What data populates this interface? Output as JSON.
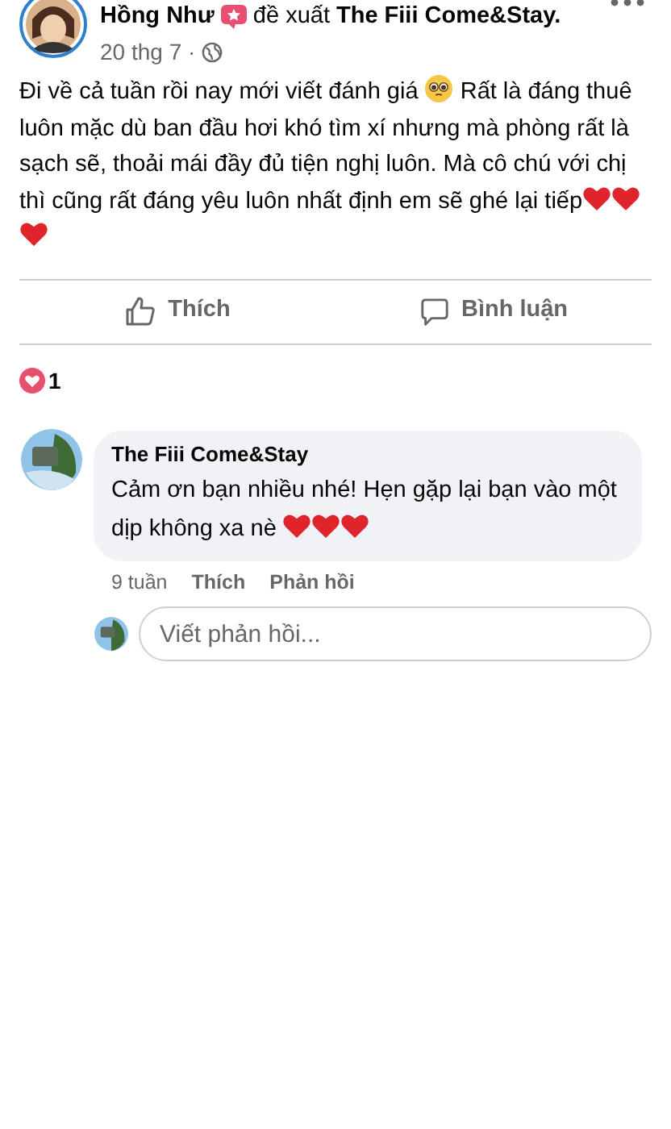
{
  "post": {
    "author": "Hồng Như",
    "action": "đề xuất",
    "page": "The Fiii Come&Stay.",
    "date": "20 thg 7 ·",
    "body": [
      {
        "kind": "text",
        "text": "Đi về cả tuần rồi nay mới viết đánh giá "
      },
      {
        "kind": "pleading-face"
      },
      {
        "kind": "text",
        "text": " Rất là đáng thuê luôn mặc dù ban đầu hơi khó tìm xí nhưng mà phòng rất là sạch sẽ, thoải mái đầy đủ tiện nghị luôn. Mà cô chú với chị thì cũng rất đáng yêu luôn nhất định em sẽ ghé lại tiếp"
      },
      {
        "kind": "heart"
      },
      {
        "kind": "heart"
      },
      {
        "kind": "heart"
      }
    ]
  },
  "actions": [
    {
      "kind": "like",
      "label": "Thích"
    },
    {
      "kind": "comment",
      "label": "Bình luận"
    }
  ],
  "reactions": {
    "count": "1"
  },
  "comment": {
    "author": "The Fiii Come&Stay",
    "body": [
      {
        "kind": "text",
        "text": "Cảm ơn bạn nhiều nhé! Hẹn gặp lại bạn vào một dịp không xa nè "
      },
      {
        "kind": "heart"
      },
      {
        "kind": "heart"
      },
      {
        "kind": "heart"
      }
    ],
    "time": "9 tuần",
    "like": "Thích",
    "reply": "Phản hồi"
  },
  "reply_field": {
    "placeholder": "Viết phản hồi..."
  }
}
